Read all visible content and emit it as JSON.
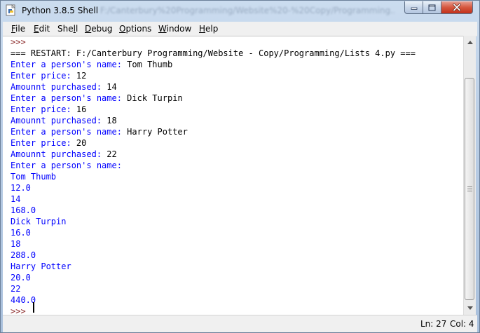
{
  "window": {
    "title": "Python 3.8.5 Shell",
    "title_path": "F:/Canterbury%20Programming/Website%20-%20Copy/Programming..."
  },
  "menu": {
    "items": [
      {
        "label": "File"
      },
      {
        "label": "Edit"
      },
      {
        "label": "Shell"
      },
      {
        "label": "Debug"
      },
      {
        "label": "Options"
      },
      {
        "label": "Window"
      },
      {
        "label": "Help"
      }
    ]
  },
  "shell": {
    "lines": [
      {
        "text": ">>>",
        "kind": "prompt"
      },
      {
        "text": "=== RESTART: F:/Canterbury Programming/Website - Copy/Programming/Lists 4.py ===",
        "kind": "black"
      },
      {
        "text": "Enter a person's name: ",
        "input": "Tom Thumb"
      },
      {
        "text": "Enter price: ",
        "input": "12"
      },
      {
        "text": "Amounnt purchased: ",
        "input": "14"
      },
      {
        "text": "Enter a person's name: ",
        "input": "Dick Turpin"
      },
      {
        "text": "Enter price: ",
        "input": "16"
      },
      {
        "text": "Amounnt purchased: ",
        "input": "18"
      },
      {
        "text": "Enter a person's name: ",
        "input": "Harry Potter"
      },
      {
        "text": "Enter price: ",
        "input": "20"
      },
      {
        "text": "Amounnt purchased: ",
        "input": "22"
      },
      {
        "text": "Enter a person's name: ",
        "input": ""
      },
      {
        "text": "Tom Thumb"
      },
      {
        "text": "12.0"
      },
      {
        "text": "14"
      },
      {
        "text": "168.0"
      },
      {
        "text": "Dick Turpin"
      },
      {
        "text": "16.0"
      },
      {
        "text": "18"
      },
      {
        "text": "288.0"
      },
      {
        "text": "Harry Potter"
      },
      {
        "text": "20.0"
      },
      {
        "text": "22"
      },
      {
        "text": "440.0"
      },
      {
        "text": ">>> ",
        "kind": "prompt"
      }
    ]
  },
  "status": {
    "ln": "Ln: 27",
    "col": "Col: 4"
  },
  "colors": {
    "output": "#0000ff",
    "input": "#000000",
    "prompt": "#8b2a2a"
  }
}
